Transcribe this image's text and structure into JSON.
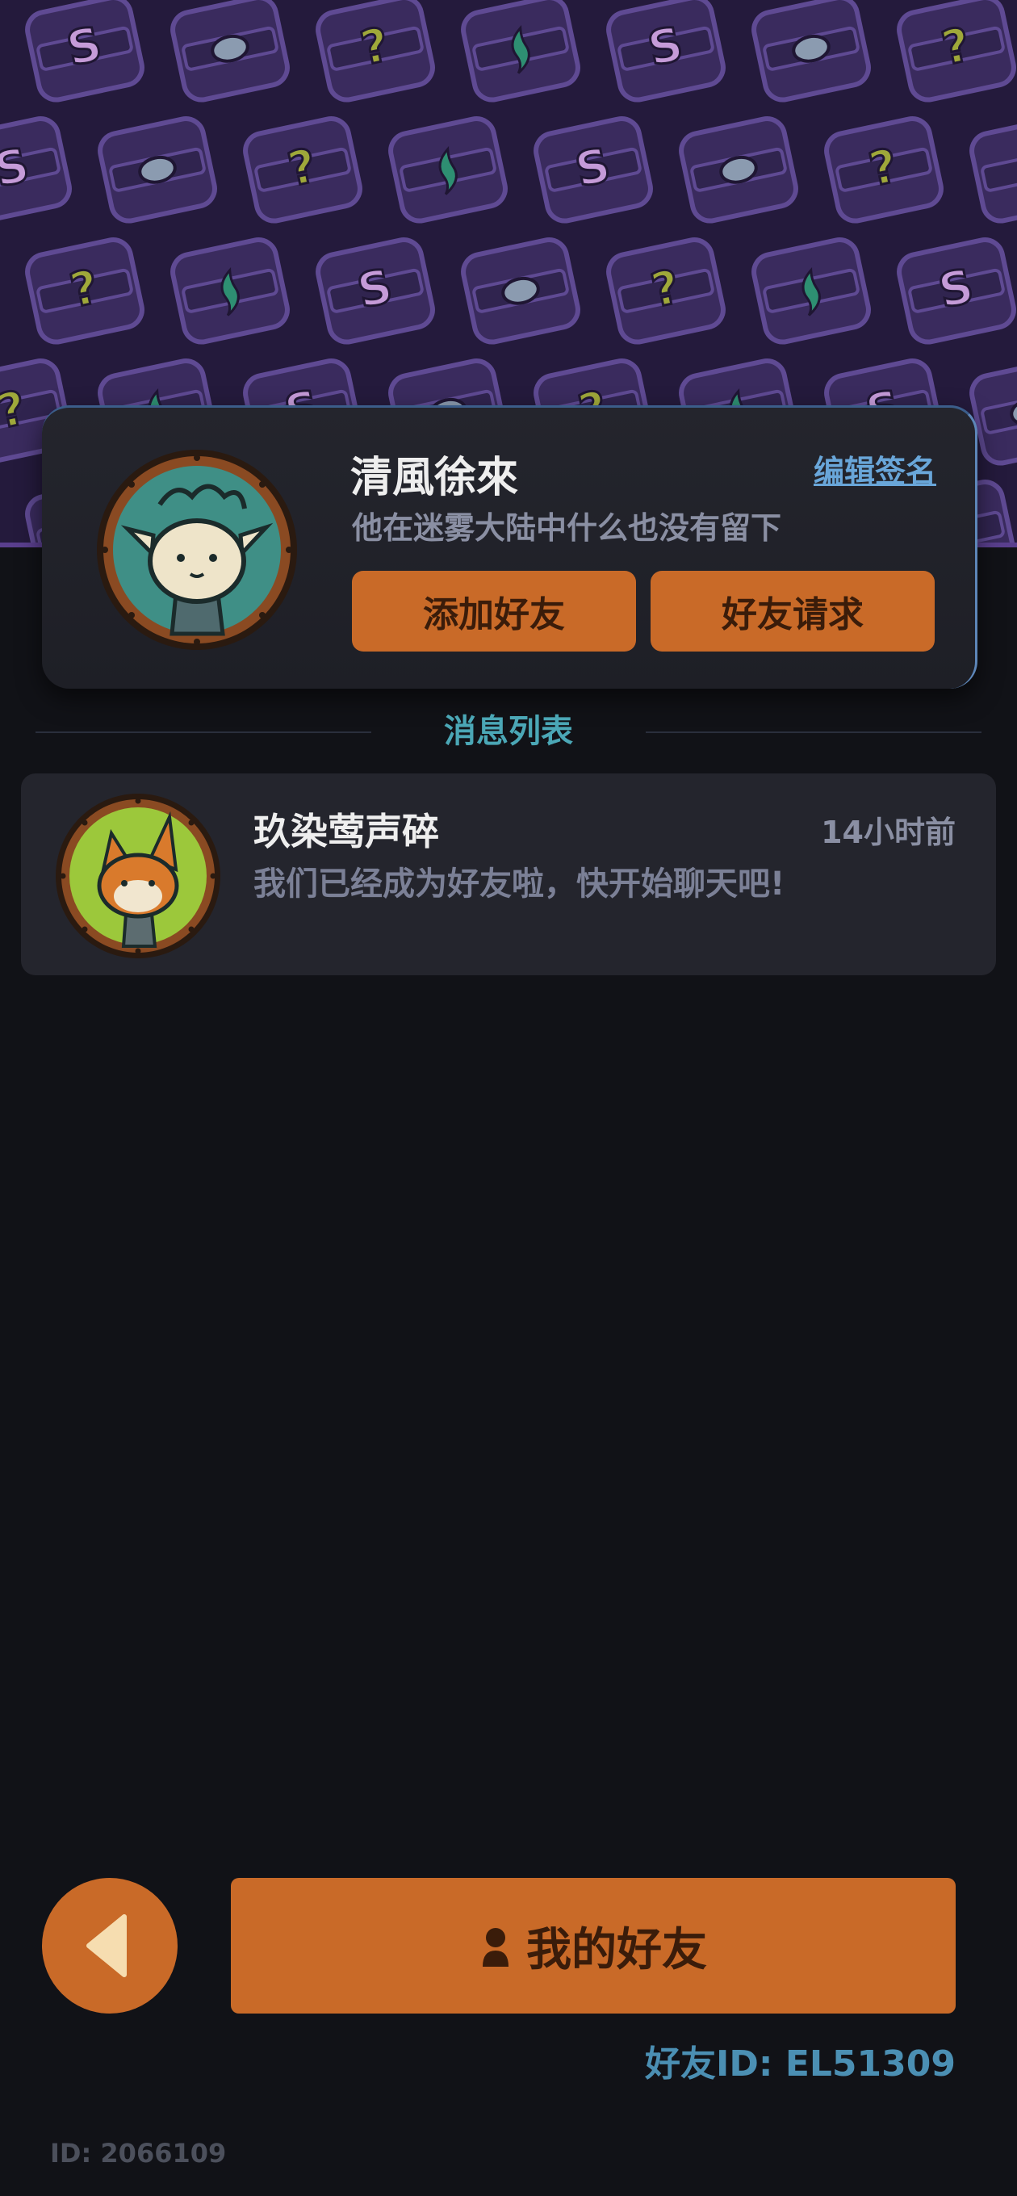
{
  "profile": {
    "name": "清風徐來",
    "signature": "他在迷雾大陆中什么也没有留下",
    "edit_signature_label": "编辑签名",
    "add_friend_label": "添加好友",
    "friend_request_label": "好友请求"
  },
  "messages": {
    "section_title": "消息列表",
    "items": [
      {
        "name": "玖染莺声碎",
        "time": "14小时前",
        "text": "我们已经成为好友啦，快开始聊天吧!"
      }
    ]
  },
  "footer": {
    "my_friends_label": "我的好友",
    "friend_id": "好友ID: EL51309",
    "player_id": "ID: 2066109"
  },
  "icons": {
    "back": "back-arrow-icon",
    "friends": "person-icon"
  },
  "colors": {
    "accent": "#c96a28",
    "banner": "#241a3c",
    "background": "#111217",
    "card": "#24252d",
    "section_title": "#4ba7b6",
    "link": "#69a6d9"
  }
}
